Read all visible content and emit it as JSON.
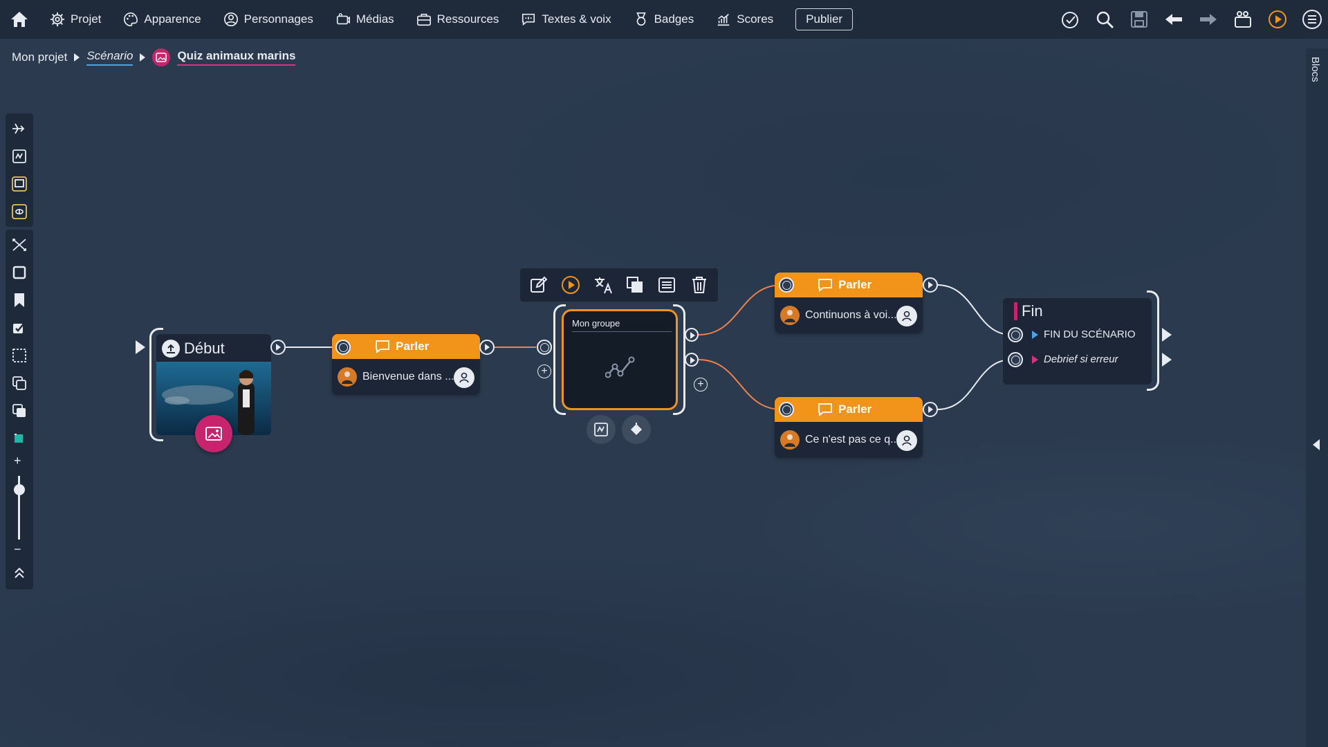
{
  "topbar": {
    "nav": [
      {
        "label": "Projet",
        "icon": "gear-icon"
      },
      {
        "label": "Apparence",
        "icon": "palette-icon"
      },
      {
        "label": "Personnages",
        "icon": "person-icon"
      },
      {
        "label": "Médias",
        "icon": "media-icon"
      },
      {
        "label": "Ressources",
        "icon": "briefcase-icon"
      },
      {
        "label": "Textes & voix",
        "icon": "speech-icon"
      },
      {
        "label": "Badges",
        "icon": "badge-icon"
      },
      {
        "label": "Scores",
        "icon": "chart-icon"
      }
    ],
    "publish_label": "Publier",
    "right_icons": [
      "check-circle-icon",
      "search-icon",
      "save-icon",
      "undo-arrow-icon",
      "redo-arrow-icon",
      "clapper-icon",
      "play-icon",
      "menu-icon"
    ]
  },
  "breadcrumb": {
    "project": "Mon projet",
    "scenario": "Scénario",
    "current": "Quiz animaux marins"
  },
  "right_panel": {
    "label": "Blocs"
  },
  "canvas": {
    "start": {
      "title": "Début"
    },
    "speak1": {
      "title": "Parler",
      "text": "Bienvenue dans ..."
    },
    "group": {
      "title": "Mon groupe"
    },
    "speak2": {
      "title": "Parler",
      "text": "Continuons à voi..."
    },
    "speak3": {
      "title": "Parler",
      "text": "Ce n'est pas ce q..."
    },
    "end": {
      "title": "Fin",
      "rows": [
        {
          "label": "FIN DU SCÉNARIO",
          "style": "normal"
        },
        {
          "label": "Debrief si erreur",
          "style": "italic"
        }
      ]
    }
  },
  "colors": {
    "accent_orange": "#f29419",
    "accent_pink": "#c8246e",
    "link_blue": "#4aa3e8",
    "background": "#2b3a4f"
  }
}
